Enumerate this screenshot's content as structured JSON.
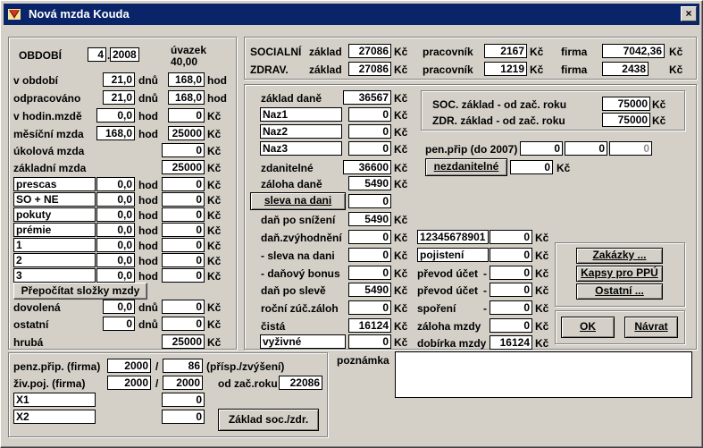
{
  "window": {
    "title": "Nová mzda Kouda",
    "close": "×"
  },
  "left": {
    "obdobi_label": "OBDOBÍ",
    "month": "4",
    "year": "2008",
    "uvazek_label": "úvazek",
    "uvazek_value": "40,00",
    "rows": [
      {
        "label": "v období",
        "v1": "21,0",
        "u1": "dnů",
        "v2": "168,0",
        "u2": "hod"
      },
      {
        "label": "odpracováno",
        "v1": "21,0",
        "u1": "dnů",
        "v2": "168,0",
        "u2": "hod"
      },
      {
        "label": "v hodin.mzdě",
        "v1": "0,0",
        "u1": "hod",
        "v2": "0",
        "u2": "Kč"
      },
      {
        "label": "měsíční mzda",
        "v1": "168,0",
        "u1": "hod",
        "v2": "25000",
        "u2": "Kč"
      },
      {
        "label": "úkolová mzda",
        "v1": "",
        "u1": "",
        "v2": "0",
        "u2": "Kč"
      },
      {
        "label": "základní mzda",
        "v1": "",
        "u1": "",
        "v2": "25000",
        "u2": "Kč"
      }
    ],
    "components": [
      {
        "name": "prescas",
        "hours": "0,0",
        "u1": "hod",
        "amount": "0",
        "u2": "Kč"
      },
      {
        "name": "SO + NE",
        "hours": "0,0",
        "u1": "hod",
        "amount": "0",
        "u2": "Kč"
      },
      {
        "name": "pokuty",
        "hours": "0,0",
        "u1": "hod",
        "amount": "0",
        "u2": "Kč"
      },
      {
        "name": "prémie",
        "hours": "0,0",
        "u1": "hod",
        "amount": "0",
        "u2": "Kč"
      },
      {
        "name": "1",
        "hours": "0,0",
        "u1": "hod",
        "amount": "0",
        "u2": "Kč"
      },
      {
        "name": "2",
        "hours": "0,0",
        "u1": "hod",
        "amount": "0",
        "u2": "Kč"
      },
      {
        "name": "3",
        "hours": "0,0",
        "u1": "hod",
        "amount": "0",
        "u2": "Kč"
      }
    ],
    "recalc_button": "Přepočítat složky mzdy",
    "dovolena": {
      "label": "dovolená",
      "v1": "0,0",
      "u1": "dnů",
      "v2": "0",
      "u2": "Kč"
    },
    "ostatni": {
      "label": "ostatní",
      "v1": "0",
      "u1": "dnů",
      "v2": "0",
      "u2": "Kč"
    },
    "hruba": {
      "label": "hrubá",
      "value": "25000",
      "unit": "Kč"
    }
  },
  "bottom": {
    "penz_label": "penz.přip. (firma)",
    "penz_v1": "2000",
    "penz_sep": "/",
    "penz_v2": "86",
    "penz_note": "(přísp./zvýšení)",
    "ziv_label": "živ.poj. (firma)",
    "ziv_v1": "2000",
    "ziv_sep": "/",
    "ziv_v2": "2000",
    "ziv_note": "od zač.roku",
    "ziv_v3": "22086",
    "x1_name": "X1",
    "x1_value": "0",
    "x2_name": "X2",
    "x2_value": "0",
    "zaklad_button": "Základ soc./zdr.",
    "poznamka_label": "poznámka",
    "poznamka_value": ""
  },
  "social": {
    "soc_label": "SOCIALNÍ",
    "zaklad_label": "základ",
    "soc_zaklad": "27086",
    "kc": "Kč",
    "pracovnik_label": "pracovník",
    "soc_pracovnik": "2167",
    "firma_label": "firma",
    "soc_firma": "7042,36",
    "zdr_label": "ZDRAV.",
    "zdr_zaklad": "27086",
    "zdr_pracovnik": "1219",
    "zdr_firma": "2438"
  },
  "tax": {
    "zaklad_dane_label": "základ daně",
    "zaklad_dane": "36567",
    "naz1": "Naz1",
    "naz1_v": "0",
    "naz2": "Naz2",
    "naz2_v": "0",
    "naz3": "Naz3",
    "naz3_v": "0",
    "zdanitelne_label": "zdanitelné",
    "zdanitelne": "36600",
    "zaloha_dane_label": "záloha daně",
    "zaloha_dane": "5490",
    "sleva_button": "sleva na dani",
    "sleva_v": "0",
    "dan_snizeni_label": "daň po snížení",
    "dan_snizeni": "5490",
    "dan_zvyh_label": "daň.zvýhodnění",
    "dan_zvyh": "0",
    "sleva_na_dani_label": "- sleva na dani",
    "sleva_na_dani": "0",
    "danovy_bonus_label": "- daňový bonus",
    "danovy_bonus": "0",
    "dan_po_sleve_label": "daň po slevě",
    "dan_po_sleve": "5490",
    "rocni_label": "roční zúč.záloh",
    "rocni": "0",
    "cista_label": "čistá",
    "cista": "16124",
    "vyzivne_name": "vyživné",
    "vyzivne": "0"
  },
  "cumul": {
    "soc_label": "SOC. základ - od zač. roku",
    "soc_value": "75000",
    "zdr_label": "ZDR. základ - od zač. roku",
    "zdr_value": "75000",
    "kc": "Kč"
  },
  "pen": {
    "label": "pen.přip (do 2007)",
    "v1": "0",
    "v2": "0",
    "v3": "0",
    "nezdanitelne_button": "nezdanitelné",
    "nezdanitelne_v": "0"
  },
  "deductions": {
    "acct_name": "12345678901",
    "acct_v": "0",
    "pojisteni_name": "pojistení",
    "pojisteni_v": "0",
    "prevod1_label": "převod účet",
    "prevod1_dash": "-",
    "prevod1_v": "0",
    "prevod2_label": "převod účet",
    "prevod2_dash": "-",
    "prevod2_v": "0",
    "sporeni_label": "spoření",
    "sporeni_dash": "-",
    "sporeni_v": "0",
    "zaloha_mzdy_label": "záloha mzdy",
    "zaloha_mzdy_v": "0",
    "dobirka_label": "dobírka mzdy",
    "dobirka_v": "16124"
  },
  "buttons": {
    "zakazky": "Zakázky ...",
    "kapsy": "Kapsy pro PPÚ",
    "ostatni": "Ostatní ...",
    "ok": "OK",
    "navrat": "Návrat"
  }
}
